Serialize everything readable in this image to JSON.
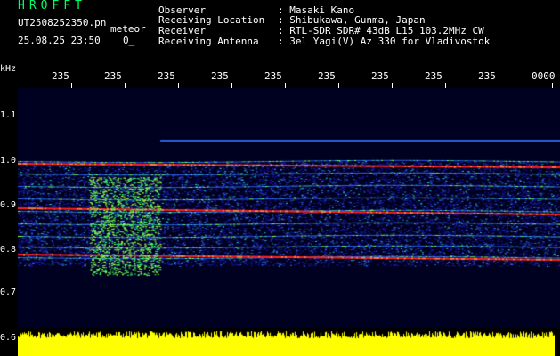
{
  "header": {
    "app_title": "HROFFT",
    "file_name": "UT2508252350.pn",
    "mode_tag": "meteor",
    "datetime": "25.08.25 23:50",
    "count": "0_"
  },
  "info": {
    "rows": [
      {
        "label": "Observer",
        "value": ": Masaki Kano"
      },
      {
        "label": "Receiving Location",
        "value": ": Shibukawa, Gunma, Japan"
      },
      {
        "label": "Receiver",
        "value": ": RTL-SDR SDR# 43dB L15 103.2MHz CW"
      },
      {
        "label": "Receiving Antenna",
        "value": ": 3el Yagi(V) Az 330 for Vladivostok"
      }
    ]
  },
  "axes": {
    "unit_label": "kHz",
    "time_ticks": [
      "235",
      "235",
      "235",
      "235",
      "235",
      "235",
      "235",
      "235",
      "235",
      "0000"
    ],
    "freq_ticks": [
      "1.1",
      "1.0",
      "0.9",
      "0.8",
      "0.7",
      "0.6"
    ]
  },
  "colors": {
    "title_green": "#00ff66",
    "background": "#000000",
    "noise_blue": "#1a1aa8",
    "carrier_red": "#ff2020",
    "meteor_green": "#33ff66",
    "signal_yellow": "#ffff00"
  }
}
